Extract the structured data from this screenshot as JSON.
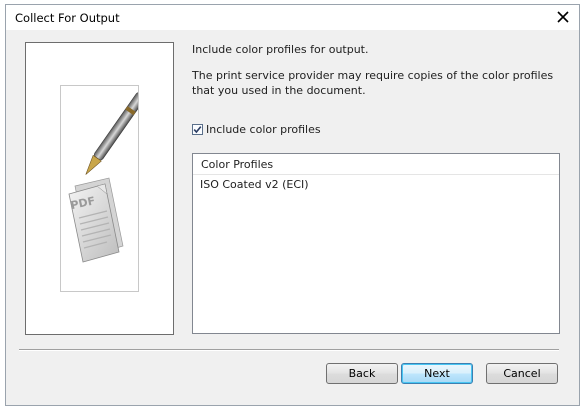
{
  "window": {
    "title": "Collect For Output",
    "close_glyph": "✕"
  },
  "artwork": {
    "icon": "pdf-document-with-pen-illustration",
    "label": "PDF"
  },
  "content": {
    "heading": "Include color profiles for output.",
    "description": "The print service provider may require copies of the color profiles that you used in the document.",
    "checkbox": {
      "label": "Include color profiles",
      "checked": true
    },
    "profiles": {
      "header": "Color Profiles",
      "items": [
        "ISO Coated v2 (ECI)"
      ]
    }
  },
  "buttons": {
    "back": "Back",
    "next": "Next",
    "cancel": "Cancel"
  },
  "colors": {
    "default_button_border": "#3c7fb1",
    "checkmark": "#2b3d63"
  }
}
